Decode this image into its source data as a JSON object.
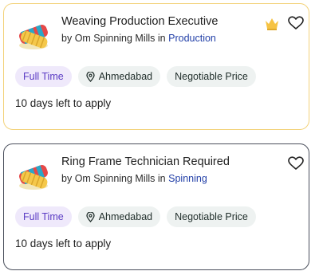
{
  "jobs": [
    {
      "title": "Weaving Production Executive",
      "by_prefix": "by",
      "company": "Om Spinning Mills",
      "in_word": "in",
      "category": "Production",
      "premium": true,
      "tags": {
        "type": "Full Time",
        "location": "Ahmedabad",
        "price": "Negotiable Price"
      },
      "deadline": "10 days left to apply"
    },
    {
      "title": "Ring Frame Technician Required",
      "by_prefix": "by",
      "company": "Om Spinning Mills",
      "in_word": "in",
      "category": "Spinning",
      "premium": false,
      "tags": {
        "type": "Full Time",
        "location": "Ahmedabad",
        "price": "Negotiable Price"
      },
      "deadline": "10 days left to apply"
    }
  ],
  "icons": {
    "logo": "yarn-spools-icon",
    "premium": "crown-icon",
    "save": "heart-icon",
    "location": "location-pin-icon"
  },
  "colors": {
    "premium_border": "#f3d27a",
    "regular_border": "#4a4f5c",
    "category_link": "#2340a8",
    "job_type_chip_bg": "#efe9fb",
    "job_type_chip_text": "#5b3cc4",
    "chip_bg": "#eef2f1",
    "crown": "#f6c343"
  }
}
